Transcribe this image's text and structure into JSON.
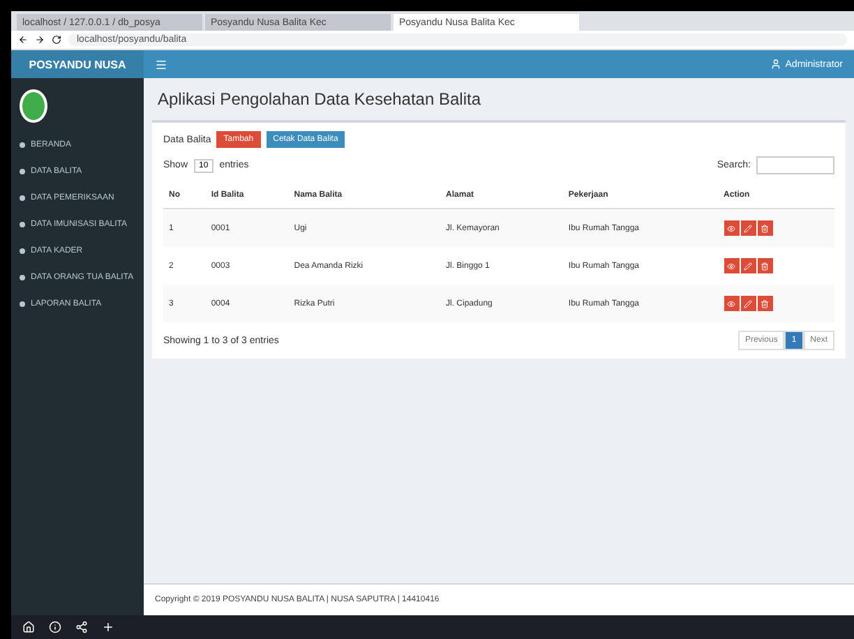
{
  "browser": {
    "tabs": [
      {
        "title": "localhost / 127.0.0.1 / db_posya",
        "selected": false
      },
      {
        "title": "Posyandu Nusa Balita Kec",
        "selected": false
      },
      {
        "title": "Posyandu Nusa Balita Kec",
        "selected": true
      }
    ],
    "address": "localhost/posyandu/balita"
  },
  "app": {
    "brand": "POSYANDU NUSA",
    "user": "Administrator"
  },
  "sidebar": {
    "items": [
      {
        "label": "BERANDA"
      },
      {
        "label": "DATA BALITA"
      },
      {
        "label": "DATA PEMERIKSAAN"
      },
      {
        "label": "DATA IMUNISASI BALITA"
      },
      {
        "label": "DATA KADER"
      },
      {
        "label": "DATA ORANG TUA BALITA"
      },
      {
        "label": "LAPORAN BALITA"
      }
    ]
  },
  "page_title": "Aplikasi Pengolahan Data Kesehatan Balita",
  "toolbar": {
    "label": "Data Balita",
    "buttons": [
      {
        "kind": "danger",
        "label": "Tambah"
      },
      {
        "kind": "primary",
        "label": "Cetak Data Balita"
      }
    ]
  },
  "table": {
    "length_label_before": "Show",
    "length_value": "10",
    "length_label_after": "entries",
    "search_label": "Search:",
    "columns": [
      "No",
      "Id Balita",
      "Nama Balita",
      "Alamat",
      "Pekerjaan",
      "Action"
    ],
    "rows": [
      {
        "cells": [
          "1",
          "0001",
          "Ugi",
          "Jl. Kemayoran",
          "Ibu Rumah Tangga"
        ]
      },
      {
        "cells": [
          "2",
          "0003",
          "Dea Amanda Rizki",
          "Jl. Binggo 1",
          "Ibu Rumah Tangga"
        ]
      },
      {
        "cells": [
          "3",
          "0004",
          "Rizka Putri",
          "Jl. Cipadung",
          "Ibu Rumah Tangga"
        ]
      }
    ],
    "info": "Showing 1 to 3 of 3 entries",
    "pagination": [
      {
        "label": "Previous",
        "selected": false
      },
      {
        "label": "1",
        "selected": true
      },
      {
        "label": "Next",
        "selected": false
      }
    ]
  },
  "footer": "Copyright © 2019 POSYANDU NUSA BALITA | NUSA SAPUTRA | 14410416"
}
